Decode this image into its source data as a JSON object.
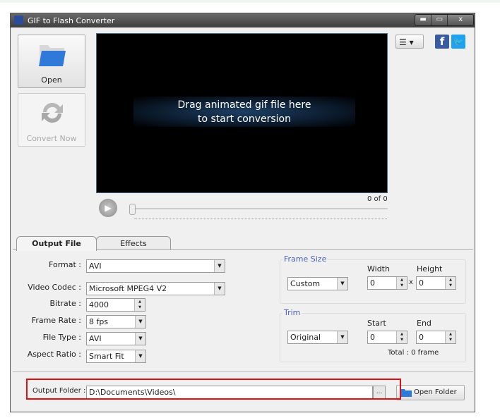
{
  "window": {
    "title": "GIF to Flash Converter",
    "minimize": "▬",
    "maximize": "▭",
    "close": "x"
  },
  "sidebar": {
    "open_label": "Open",
    "convert_label": "Convert Now"
  },
  "preview": {
    "line1": "Drag animated gif file here",
    "line2": "to start conversion",
    "counter": "0 of 0",
    "progress": 0
  },
  "tabs": [
    {
      "label": "Output File",
      "active": true
    },
    {
      "label": "Effects",
      "active": false
    }
  ],
  "form": {
    "format": {
      "label": "Format :",
      "value": "AVI"
    },
    "codec": {
      "label": "Video Codec :",
      "value": "Microsoft MPEG4 V2"
    },
    "bitrate": {
      "label": "Bitrate :",
      "value": "4000"
    },
    "framerate": {
      "label": "Frame Rate :",
      "value": "8 fps"
    },
    "filetype": {
      "label": "File Type :",
      "value": "AVI"
    },
    "aspect": {
      "label": "Aspect Ratio :",
      "value": "Smart Fit"
    }
  },
  "frame_size": {
    "title": "Frame Size",
    "mode": "Custom",
    "width_label": "Width",
    "height_label": "Height",
    "width": "0",
    "height": "0",
    "x": "x"
  },
  "trim": {
    "title": "Trim",
    "mode": "Original",
    "start_label": "Start",
    "end_label": "End",
    "start": "0",
    "end": "0",
    "total": "Total : 0 frame"
  },
  "output": {
    "label": "Output Folder :",
    "path": "D:\\Documents\\Videos\\",
    "browse": "...",
    "open_folder": "Open Folder"
  },
  "colors": {
    "highlight": "#d11111",
    "group_title": "#4a5fc0"
  }
}
